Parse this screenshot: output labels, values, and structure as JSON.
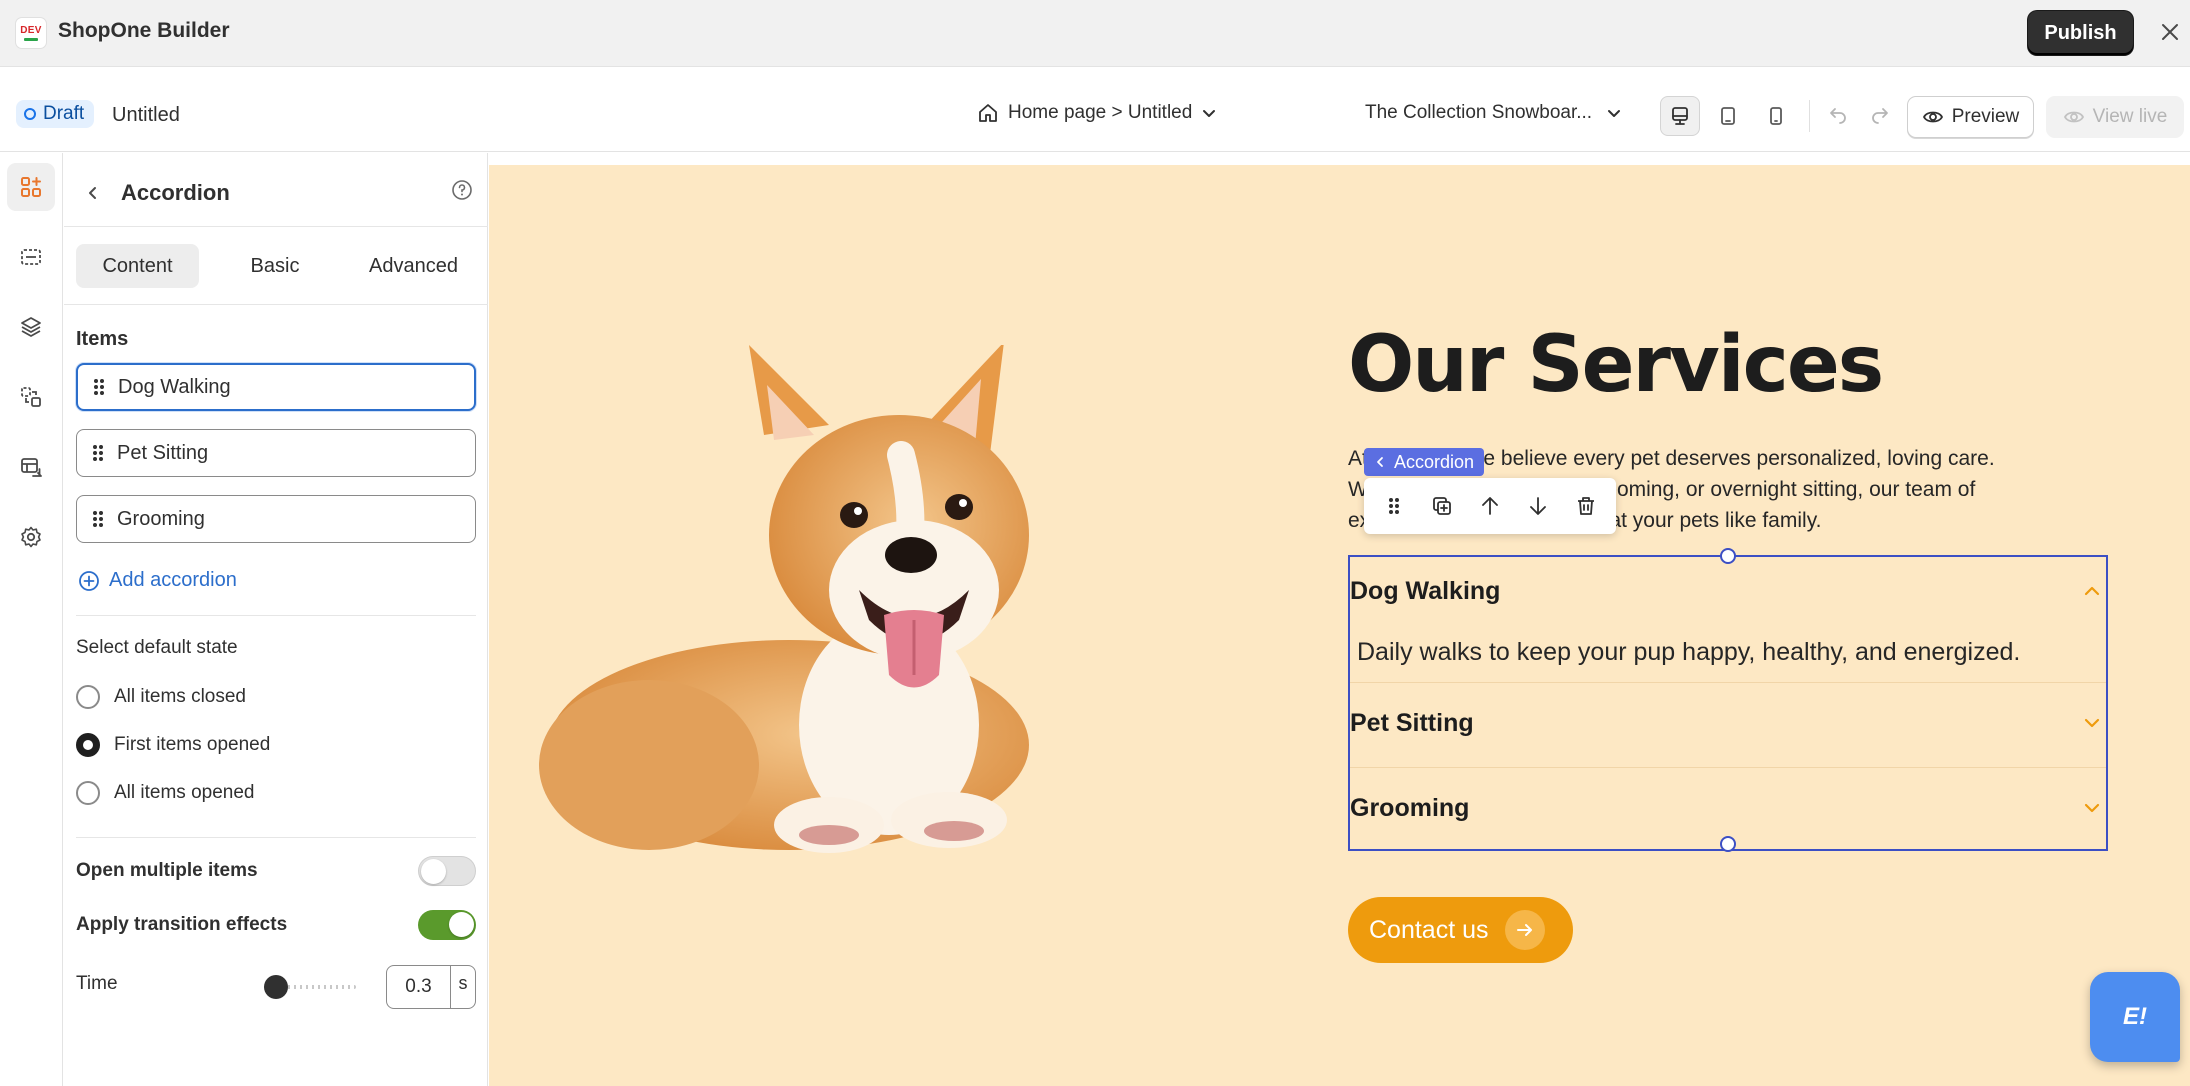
{
  "app": {
    "logo_text": "DEV",
    "title": "ShopOne Builder",
    "publish_label": "Publish",
    "close_icon": "close-icon"
  },
  "toolbar": {
    "status_badge": "Draft",
    "page_name": "Untitled",
    "breadcrumb": "Home page > Untitled",
    "product_select": "The Collection Snowboar...",
    "devices": [
      "desktop",
      "tablet",
      "mobile"
    ],
    "active_device": "desktop",
    "preview_label": "Preview",
    "view_live_label": "View live"
  },
  "rail": {
    "items": [
      "add-elements-icon",
      "sections-icon",
      "layers-icon",
      "components-icon",
      "templates-icon",
      "settings-icon"
    ],
    "active": "add-elements-icon"
  },
  "panel": {
    "title": "Accordion",
    "tabs": [
      "Content",
      "Basic",
      "Advanced"
    ],
    "active_tab": "Content",
    "items_label": "Items",
    "items": [
      "Dog Walking",
      "Pet Sitting",
      "Grooming"
    ],
    "add_label": "Add accordion",
    "default_state_label": "Select default state",
    "default_state_options": [
      "All items closed",
      "First items opened",
      "All items opened"
    ],
    "default_state_selected": "First items opened",
    "open_multiple_label": "Open multiple items",
    "open_multiple": false,
    "transition_label": "Apply transition effects",
    "transition": true,
    "time_label": "Time",
    "time_value": "0.3",
    "time_unit": "s"
  },
  "canvas": {
    "heading": "Our Services",
    "paragraph": "At Pet Care, we believe every pet deserves personalized, loving care. Whether it's dog walking, grooming, or overnight sitting, our team of experts is always here to treat your pets like family.",
    "selection_chip": "Accordion",
    "accordion": [
      {
        "title": "Dog Walking",
        "body": "Daily walks to keep your pup happy, healthy, and energized.",
        "open": true
      },
      {
        "title": "Pet Sitting",
        "open": false
      },
      {
        "title": "Grooming",
        "open": false
      }
    ],
    "cta_label": "Contact us",
    "chat_label": "E!",
    "colors": {
      "page_bg": "#fde8c4",
      "accent": "#ee9b0d",
      "selection": "#3c4fc4"
    }
  }
}
